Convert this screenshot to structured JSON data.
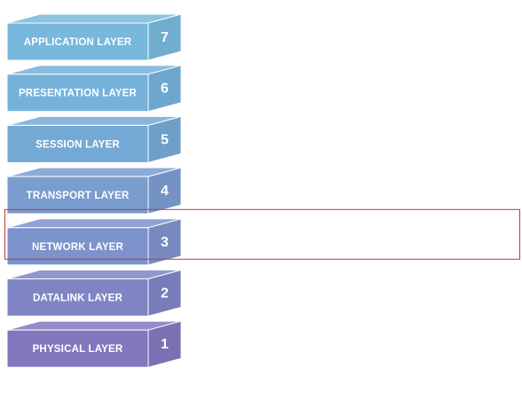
{
  "layers": [
    {
      "label": "APPLICATION LAYER",
      "number": "7",
      "color": "#77b8dc"
    },
    {
      "label": "PRESENTATION LAYER",
      "number": "6",
      "color": "#76b1da"
    },
    {
      "label": "SESSION LAYER",
      "number": "5",
      "color": "#75a9d5"
    },
    {
      "label": "TRANSPORT LAYER",
      "number": "4",
      "color": "#7a9ccf"
    },
    {
      "label": "NETWORK LAYER",
      "number": "3",
      "color": "#7d93cc"
    },
    {
      "label": "DATALINK LAYER",
      "number": "2",
      "color": "#7f85c4"
    },
    {
      "label": "PHYSICAL LAYER",
      "number": "1",
      "color": "#8277bd"
    }
  ],
  "highlighted_layer": "NETWORK LAYER",
  "highlight_color": "#c0393b"
}
